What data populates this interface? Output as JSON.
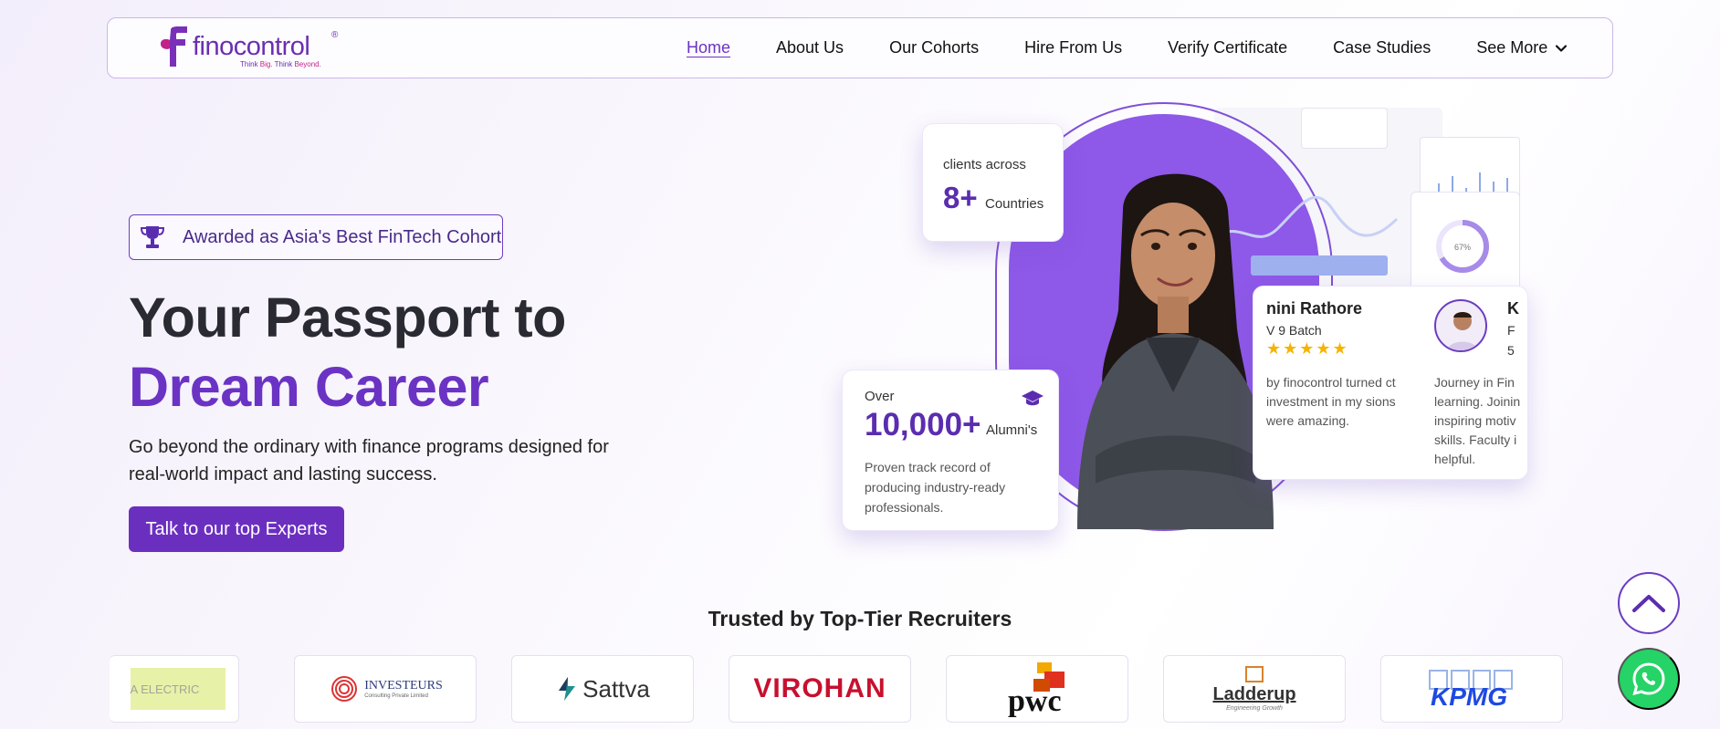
{
  "nav": {
    "logo_word": "finocontrol",
    "logo_reg": "®",
    "logo_tag_a": "Think ",
    "logo_tag_b": "Big",
    "logo_tag_c": ". Think ",
    "logo_tag_d": "Beyond",
    "logo_tag_e": ".",
    "links": [
      "Home",
      "About Us",
      "Our Cohorts",
      "Hire From Us",
      "Verify Certificate",
      "Case Studies",
      "See More"
    ],
    "active": "Home"
  },
  "hero": {
    "award": "Awarded as Asia's Best FinTech Cohort",
    "title_line1": "Your Passport to",
    "title_line2": "Dream Career",
    "subtitle": "Go beyond the ordinary with finance programs designed for real-world impact and lasting success.",
    "cta": "Talk to our top Experts"
  },
  "stats": {
    "countries_small": "clients across",
    "countries_num": "8+",
    "countries_unit": "Countries",
    "alumni_over": "Over",
    "alumni_num": "10,000+",
    "alumni_unit": "Alumni's",
    "alumni_desc": "Proven track record of producing industry-ready professionals."
  },
  "review": {
    "name": "nini Rathore",
    "batch": "V 9 Batch",
    "stars": "★★★★★",
    "text": "by finocontrol turned ct investment in my sions were amazing.",
    "second_name": "K",
    "second_line1": "F",
    "second_line2": "5",
    "second_text_1": "Journey in Fin",
    "second_text_2": "learning. Joinin",
    "second_text_3": "inspiring motiv",
    "second_text_4": "skills. Faculty i",
    "second_text_5": "helpful.",
    "donut_label": "67%"
  },
  "recruiters": {
    "heading": "Trusted by Top-Tier Recruiters",
    "logos": [
      "A ELECTRIC",
      "INVESTEURS",
      "Sattva",
      "VIROHAN",
      "pwc",
      "Ladderup",
      "KPMG"
    ],
    "investeurs_sub": "Consulting Private Limited",
    "ladderup_sub": "Engineering Growth"
  },
  "colors": {
    "brand": "#6b2fc0",
    "accent": "#6b33c4",
    "whatsapp": "#25d366"
  }
}
